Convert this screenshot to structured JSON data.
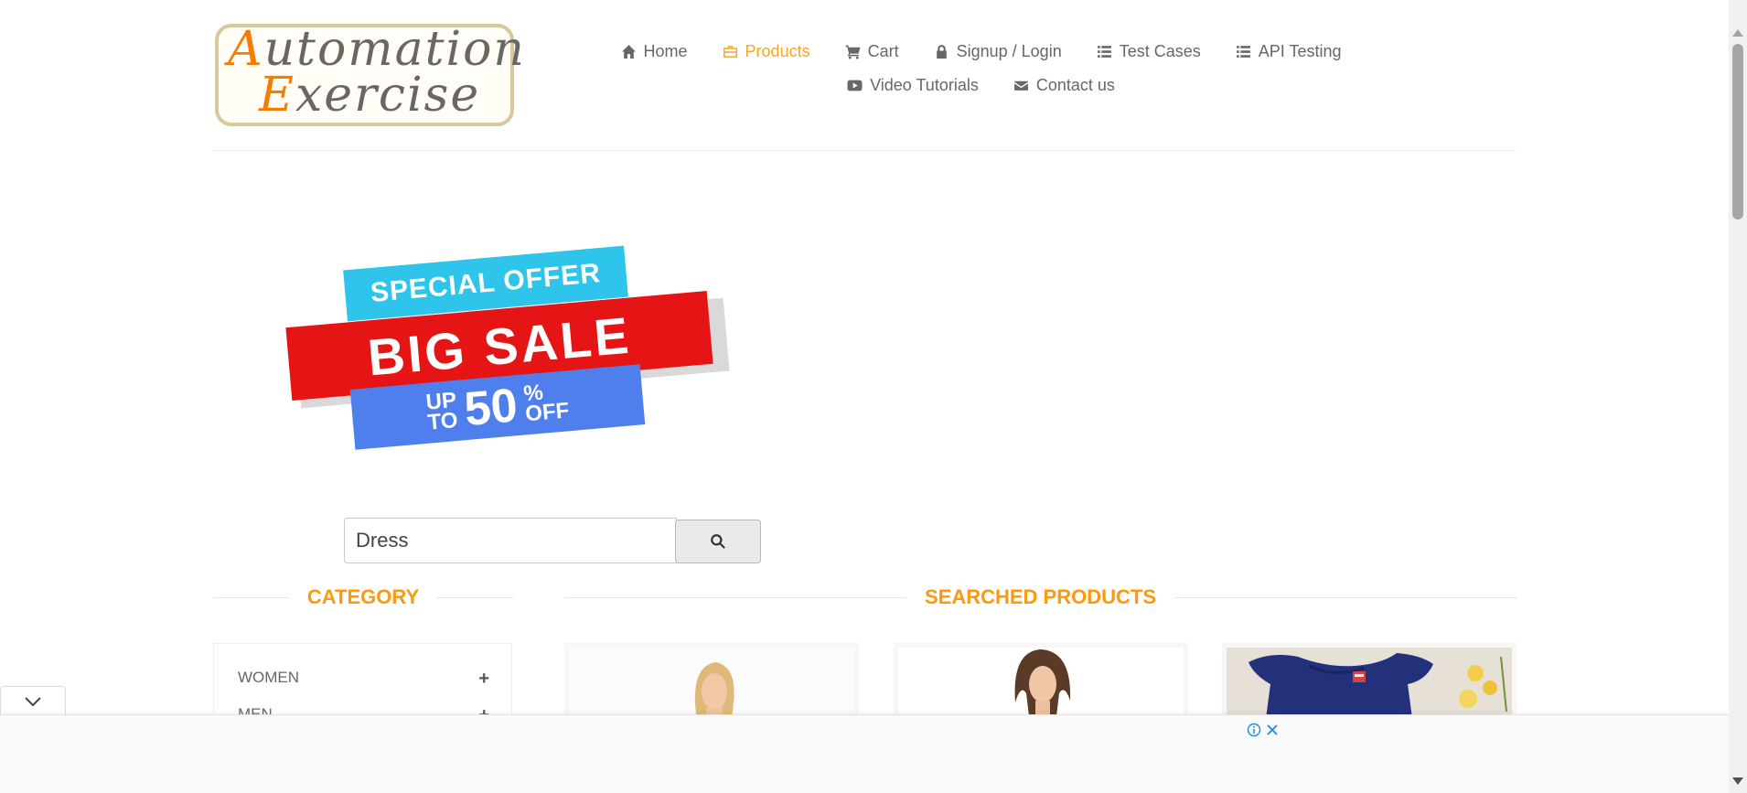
{
  "header": {
    "logo": {
      "line1": "Automation",
      "line2": "Exercise"
    },
    "nav": [
      {
        "label": "Home",
        "icon": "home-icon"
      },
      {
        "label": "Products",
        "icon": "briefcase-icon",
        "active": true
      },
      {
        "label": "Cart",
        "icon": "cart-icon"
      },
      {
        "label": "Signup / Login",
        "icon": "lock-icon"
      },
      {
        "label": "Test Cases",
        "icon": "list-icon"
      },
      {
        "label": "API Testing",
        "icon": "list-icon"
      },
      {
        "label": "Video Tutorials",
        "icon": "video-icon"
      },
      {
        "label": "Contact us",
        "icon": "envelope-icon"
      }
    ]
  },
  "banner": {
    "line1": "SPECIAL OFFER",
    "line2": "BIG SALE",
    "line3_prefix_top": "UP",
    "line3_prefix_bottom": "TO",
    "line3_value": "50",
    "line3_percent": "%",
    "line3_suffix": "OFF"
  },
  "search": {
    "value": "Dress",
    "button_icon": "search-icon"
  },
  "category": {
    "title": "CATEGORY",
    "items": [
      {
        "label": "WOMEN"
      },
      {
        "label": "MEN"
      }
    ]
  },
  "products": {
    "title": "SEARCHED PRODUCTS"
  },
  "colors": {
    "accent": "#fe980f",
    "active_nav": "#f5a623",
    "text": "#696763"
  }
}
